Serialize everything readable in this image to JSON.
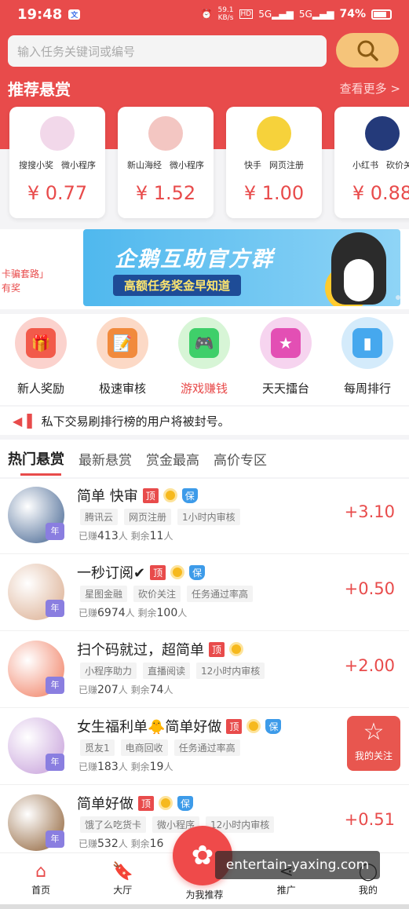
{
  "status": {
    "time": "19:48",
    "sim": "文",
    "speed": "59.1",
    "speed_unit": "KB/s",
    "hd": "HD",
    "net1": "5G",
    "net2": "5G",
    "battery": "74%"
  },
  "search": {
    "placeholder": "输入任务关键词或编号"
  },
  "recommend": {
    "title": "推荐悬赏",
    "more": "查看更多 >",
    "cards": [
      {
        "tags": [
          "搜搜小奖",
          "微小程序"
        ],
        "price": "¥ 0.77",
        "color": "#f2d8ea"
      },
      {
        "tags": [
          "新山海经",
          "微小程序"
        ],
        "price": "¥ 1.52",
        "color": "#f3c6c2"
      },
      {
        "tags": [
          "快手",
          "网页注册"
        ],
        "price": "¥ 1.00",
        "color": "#f6d23b"
      },
      {
        "tags": [
          "小红书",
          "砍价关"
        ],
        "price": "¥ 0.88",
        "color": "#243a7a"
      }
    ]
  },
  "banner": {
    "title": "企鹅互助官方群",
    "subtitle": "高额任务奖金早知道",
    "side1": "卡骗套路」",
    "side2": "有奖"
  },
  "icons": [
    {
      "label": "新人奖励",
      "color": "#fbd2cd",
      "inner": "#f25a4a",
      "glyph": "🎁"
    },
    {
      "label": "极速审核",
      "color": "#fcd9c6",
      "inner": "#f18a3c",
      "glyph": "📝"
    },
    {
      "label": "游戏赚钱",
      "color": "#d7f5d6",
      "inner": "#3fcf6a",
      "glyph": "🎮"
    },
    {
      "label": "天天擂台",
      "color": "#f6d4ef",
      "inner": "#e34fb4",
      "glyph": "★"
    },
    {
      "label": "每周排行",
      "color": "#d4ebfb",
      "inner": "#46a8ee",
      "glyph": "▮"
    }
  ],
  "notice": {
    "text": "私下交易刷排行榜的用户将被封号。"
  },
  "tabs": [
    {
      "label": "热门悬赏"
    },
    {
      "label": "最新悬赏"
    },
    {
      "label": "赏金最高"
    },
    {
      "label": "高价专区"
    }
  ],
  "tasks": [
    {
      "title": "简单 快审",
      "badges": [
        "顶",
        "coin",
        "保"
      ],
      "tags": [
        "腾讯云",
        "网页注册",
        "1小时内审核"
      ],
      "earned_label": "已赚",
      "earned": "413",
      "earned_unit": "人",
      "left_label": "剩余",
      "left": "11",
      "left_unit": "人",
      "reward": "+3.10",
      "thumb": "#3b5d8c",
      "year": "年"
    },
    {
      "title": "一秒订阅✔",
      "badges": [
        "顶",
        "coin",
        "保"
      ],
      "tags": [
        "星图金融",
        "砍价关注",
        "任务通过率高"
      ],
      "earned_label": "已赚",
      "earned": "6974",
      "earned_unit": "人",
      "left_label": "剩余",
      "left": "100",
      "left_unit": "人",
      "reward": "+0.50",
      "thumb": "#d9a98a",
      "year": "年"
    },
    {
      "title": "扫个码就过，超简单",
      "badges": [
        "顶",
        "coin"
      ],
      "tags": [
        "小程序助力",
        "直播阅读",
        "12小时内审核"
      ],
      "earned_label": "已赚",
      "earned": "207",
      "earned_unit": "人",
      "left_label": "剩余",
      "left": "74",
      "left_unit": "人",
      "reward": "+2.00",
      "thumb": "#f0785a",
      "year": "年"
    },
    {
      "title": "女生福利单🐥简单好做",
      "badges": [
        "顶",
        "coin",
        "保"
      ],
      "tags": [
        "觅友1",
        "电商回收",
        "任务通过率高"
      ],
      "earned_label": "已赚",
      "earned": "183",
      "earned_unit": "人",
      "left_label": "剩余",
      "left": "19",
      "left_unit": "人",
      "reward": "",
      "thumb": "#c39ad8",
      "year": "年"
    },
    {
      "title": "简单好做",
      "badges": [
        "顶",
        "coin",
        "保"
      ],
      "tags": [
        "饿了么吃货卡",
        "微小程序",
        "12小时内审核"
      ],
      "earned_label": "已赚",
      "earned": "532",
      "earned_unit": "人",
      "left_label": "剩余",
      "left": "16",
      "left_unit": "",
      "reward": "+0.51",
      "thumb": "#8a5a2e",
      "year": "年"
    }
  ],
  "follow": {
    "label": "我的关注"
  },
  "nav": [
    {
      "label": "首页",
      "icon": "home-icon",
      "glyph": "⌂"
    },
    {
      "label": "大厅",
      "icon": "bookmark-icon",
      "glyph": "🔖"
    },
    {
      "label": "为我推荐",
      "icon": "star-icon",
      "glyph": ""
    },
    {
      "label": "推广",
      "icon": "share-icon",
      "glyph": "⋖"
    },
    {
      "label": "我的",
      "icon": "user-icon",
      "glyph": "◯"
    }
  ],
  "watermark": "entertain-yaxing.com"
}
